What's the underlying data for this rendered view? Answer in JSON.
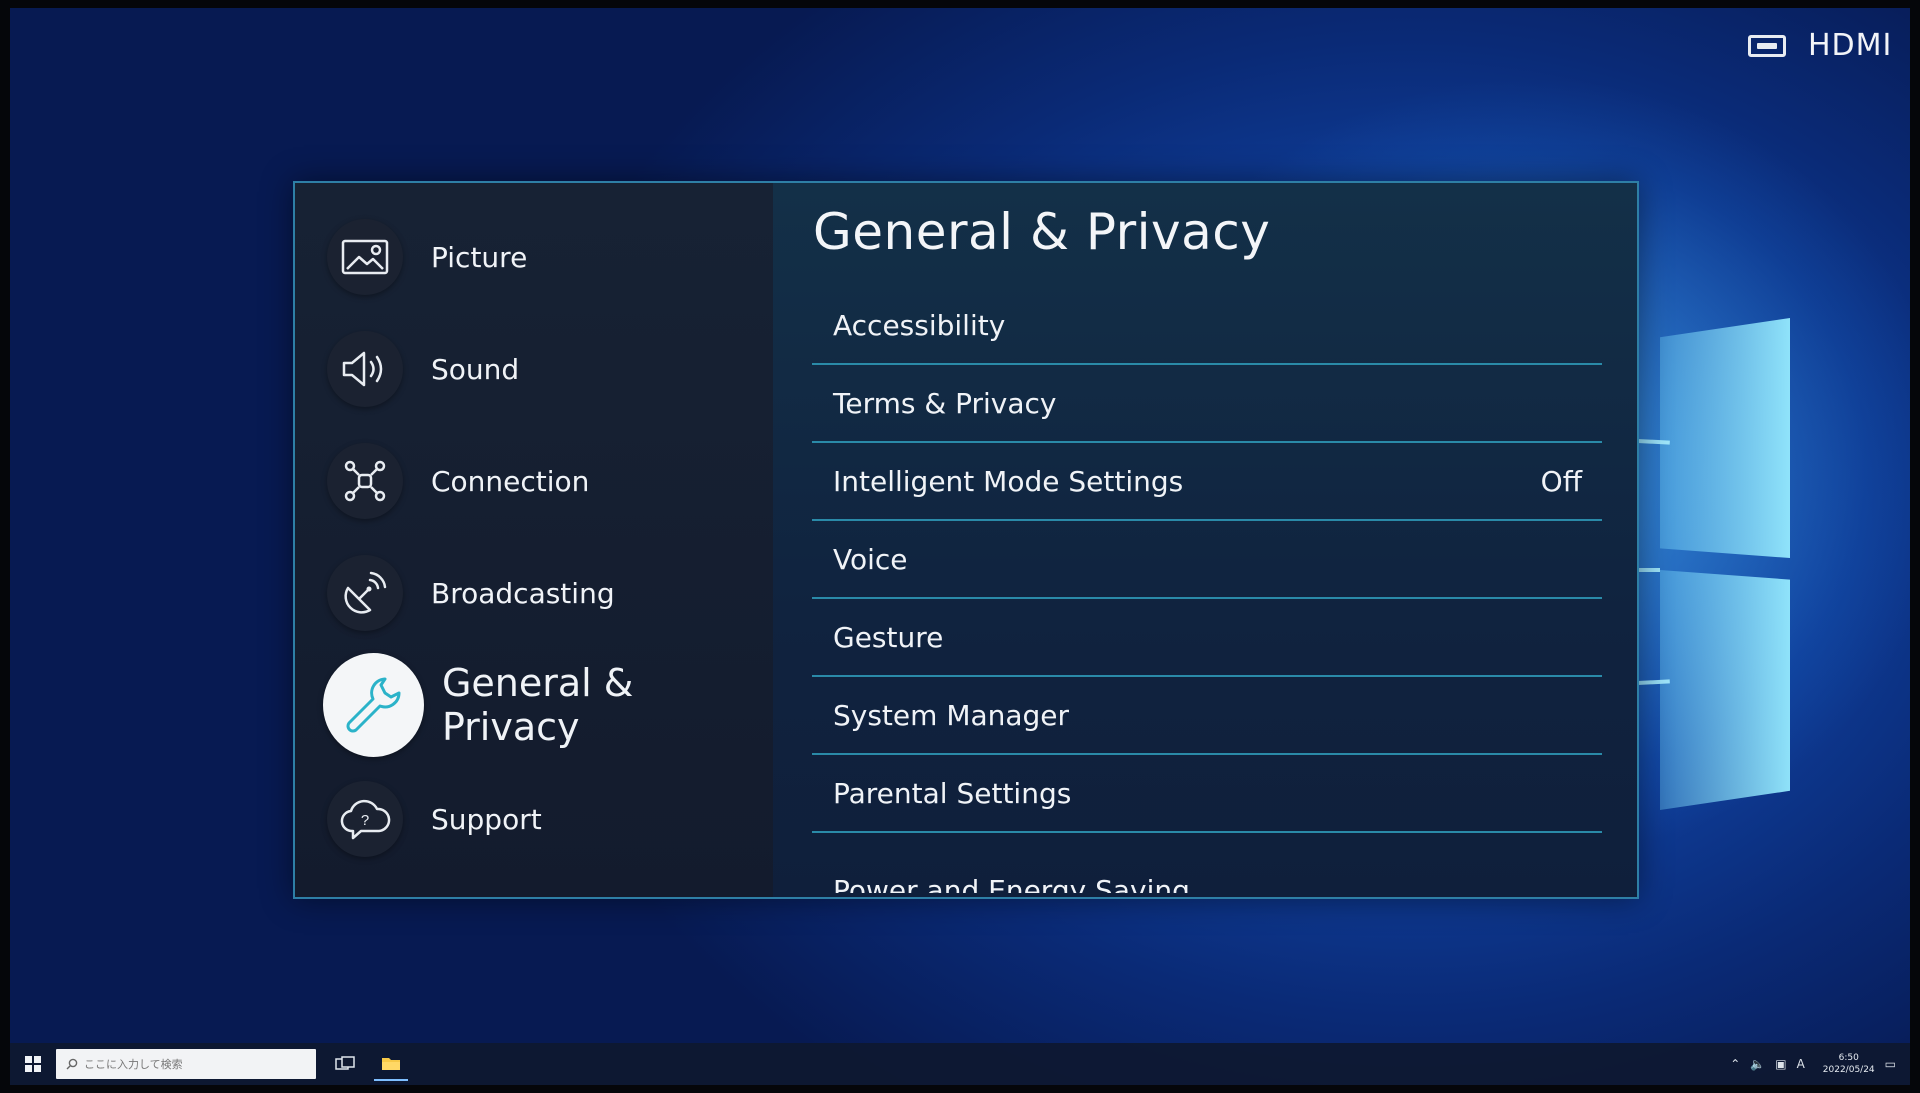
{
  "tv": {
    "source_icon": "hdmi-port-icon",
    "source_label": "HDMI"
  },
  "settings": {
    "nav": [
      {
        "label": "Picture",
        "icon": "picture-icon",
        "active": false
      },
      {
        "label": "Sound",
        "icon": "speaker-icon",
        "active": false
      },
      {
        "label": "Connection",
        "icon": "network-icon",
        "active": false
      },
      {
        "label": "Broadcasting",
        "icon": "satellite-icon",
        "active": false
      },
      {
        "label": "General & Privacy",
        "icon": "wrench-icon",
        "active": true
      },
      {
        "label": "Support",
        "icon": "help-cloud-icon",
        "active": false
      }
    ],
    "title": "General & Privacy",
    "menu": [
      {
        "label": "Accessibility",
        "value": ""
      },
      {
        "label": "Terms & Privacy",
        "value": ""
      },
      {
        "label": "Intelligent Mode Settings",
        "value": "Off"
      },
      {
        "label": "Voice",
        "value": ""
      },
      {
        "label": "Gesture",
        "value": ""
      },
      {
        "label": "System Manager",
        "value": ""
      },
      {
        "label": "Parental Settings",
        "value": ""
      },
      {
        "label": "Power and Energy Saving",
        "value": ""
      }
    ]
  },
  "taskbar": {
    "search_placeholder": "ここに入力して検索",
    "ime_indicator": "A",
    "time": "6:50",
    "date": "2022/05/24"
  },
  "colors": {
    "accent": "#2a8aa8",
    "active_icon": "#2bb3c9",
    "desktop_blue": "#0f3d98"
  }
}
